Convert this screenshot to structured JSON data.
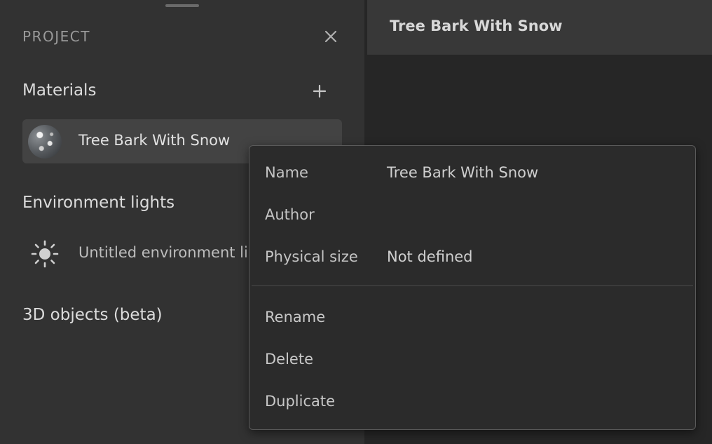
{
  "panel": {
    "title": "PROJECT",
    "icons": {
      "close": "close-icon",
      "add": "plus-icon",
      "env": "sun-icon"
    },
    "sections": {
      "materials": {
        "title": "Materials",
        "items": [
          {
            "label": "Tree Bark With Snow"
          }
        ]
      },
      "environment_lights": {
        "title": "Environment lights",
        "items": [
          {
            "label": "Untitled environment light"
          }
        ]
      },
      "objects": {
        "title": "3D objects (beta)"
      }
    }
  },
  "viewport": {
    "title": "Tree Bark With Snow"
  },
  "context_menu": {
    "properties": [
      {
        "key": "Name",
        "value": "Tree Bark With Snow"
      },
      {
        "key": "Author",
        "value": ""
      },
      {
        "key": "Physical size",
        "value": "Not defined"
      }
    ],
    "actions": [
      {
        "label": "Rename"
      },
      {
        "label": "Delete"
      },
      {
        "label": "Duplicate"
      }
    ]
  },
  "colors": {
    "panel_bg": "#323232",
    "selected_item_bg": "#434343",
    "canvas_bg": "#262626",
    "menu_bg": "#2b2b2b"
  }
}
